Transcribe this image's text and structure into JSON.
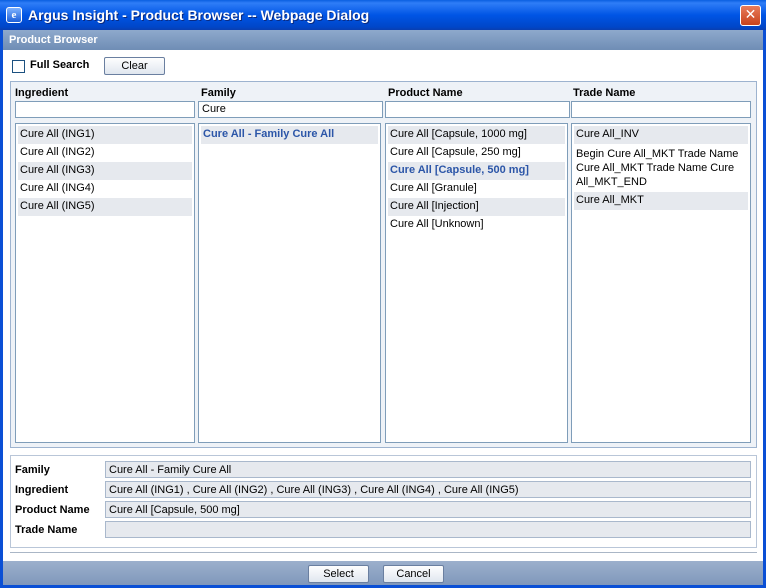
{
  "window": {
    "title": "Argus Insight - Product Browser -- Webpage Dialog",
    "icon": "ie-icon",
    "close": "✕"
  },
  "header": {
    "title": "Product Browser"
  },
  "controls": {
    "full_search_label": "Full Search",
    "full_search_checked": false,
    "clear_label": "Clear"
  },
  "columns": {
    "ingredient": {
      "header": "Ingredient",
      "filter": "",
      "items": [
        "Cure All (ING1)",
        "Cure All (ING2)",
        "Cure All (ING3)",
        "Cure All (ING4)",
        "Cure All (ING5)"
      ]
    },
    "family": {
      "header": "Family",
      "filter": "Cure",
      "items": [
        "Cure All - Family Cure All"
      ]
    },
    "product": {
      "header": "Product Name",
      "filter": "",
      "items": [
        "Cure All [Capsule, 1000 mg]",
        "Cure All [Capsule, 250 mg]",
        "Cure All [Capsule, 500 mg]",
        "Cure All [Granule]",
        "Cure All [Injection]",
        "Cure All [Unknown]"
      ]
    },
    "trade": {
      "header": "Trade Name",
      "filter": "",
      "items": [
        "Cure All_INV",
        "Begin Cure All_MKT Trade Name Cure All_MKT Trade Name Cure All_MKT_END",
        "Cure All_MKT"
      ]
    }
  },
  "summary": {
    "family_label": "Family",
    "family_value": "Cure All - Family Cure All",
    "ingredient_label": "Ingredient",
    "ingredient_value": "Cure All (ING1) , Cure All (ING2) , Cure All (ING3) , Cure All (ING4) , Cure All (ING5)",
    "product_label": "Product Name",
    "product_value": "Cure All [Capsule, 500 mg]",
    "trade_label": "Trade Name",
    "trade_value": ""
  },
  "footer": {
    "select_label": "Select",
    "cancel_label": "Cancel"
  }
}
